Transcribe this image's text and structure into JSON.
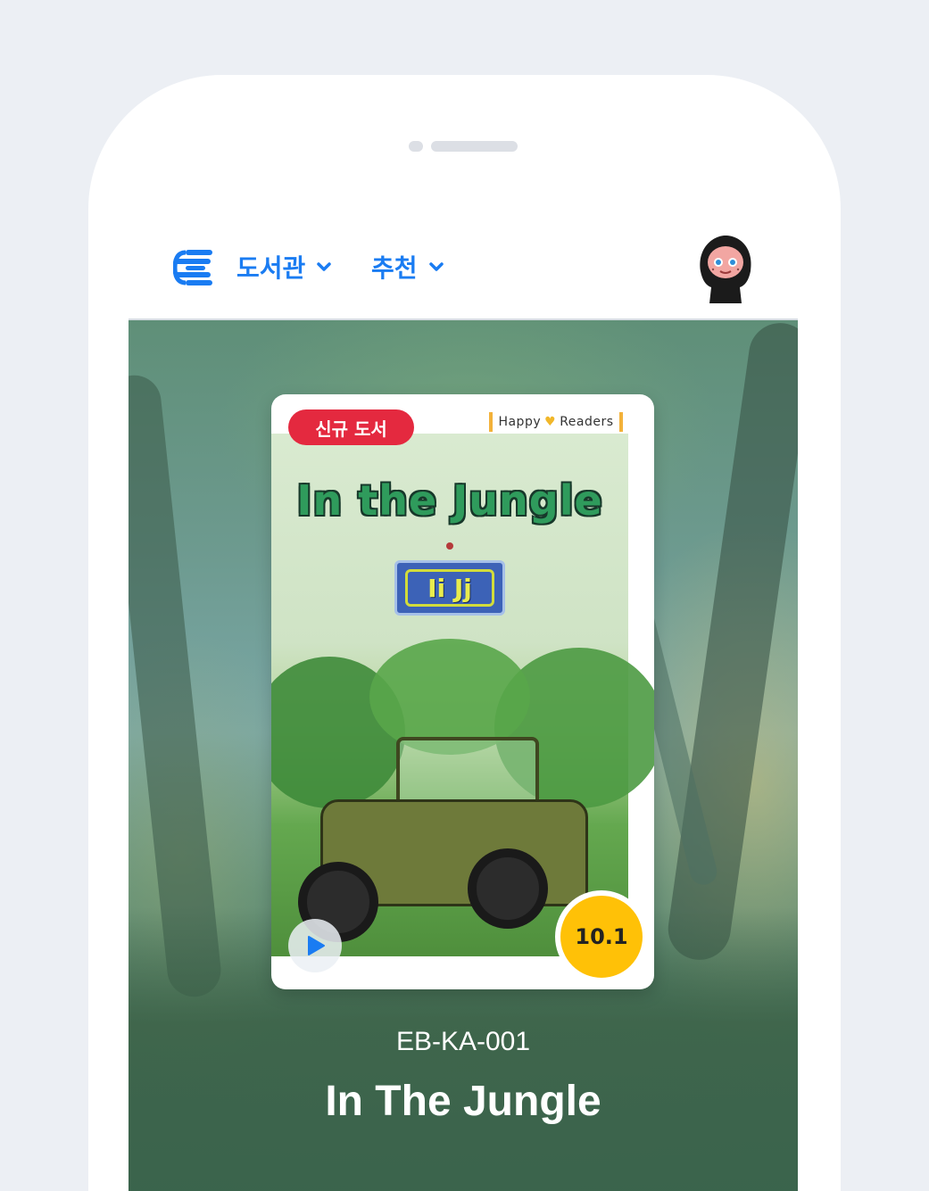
{
  "nav": {
    "menu_library": "도서관",
    "menu_recommend": "추천",
    "logo_icon": "app-logo-icon",
    "chevron_icon": "chevron-down-icon",
    "avatar_icon": "user-avatar"
  },
  "book": {
    "badge": "신규 도서",
    "publisher_left": "Happy",
    "publisher_right": "Readers",
    "cover_title": "In the Jungle",
    "cover_sign": "Ii Jj",
    "level": "10.1",
    "code": "EB-KA-001",
    "title": "In The Jungle"
  },
  "colors": {
    "accent": "#1a7cf2",
    "badge_red": "#e4293f",
    "level_yellow": "#ffc107"
  }
}
